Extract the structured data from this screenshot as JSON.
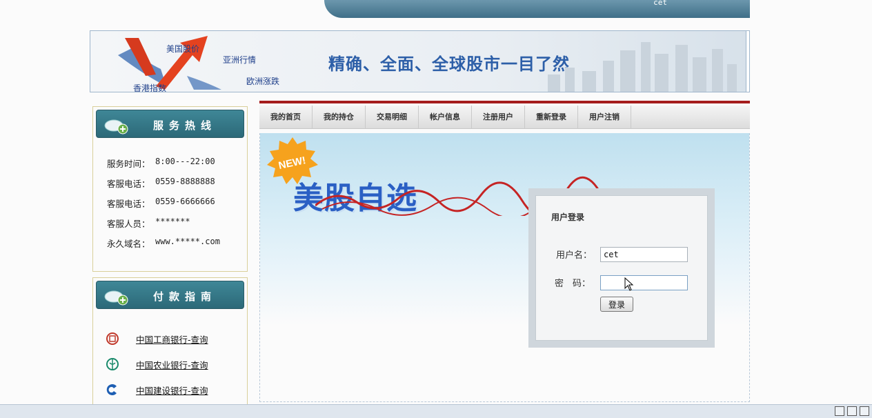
{
  "top_bar": {
    "username": "cet"
  },
  "banner": {
    "labels": {
      "us": "美国股价",
      "asia": "亚洲行情",
      "hk": "香港指数",
      "eu": "欧洲涨跌"
    },
    "slogan": "精确、全面、全球股市一目了然"
  },
  "service": {
    "title": "服务热线",
    "items": [
      {
        "label": "服务时间：",
        "value": "8:00---22:00"
      },
      {
        "label": "客服电话：",
        "value": "0559-8888888"
      },
      {
        "label": "客服电话：",
        "value": "0559-6666666"
      },
      {
        "label": "客服人员：",
        "value": "*******"
      },
      {
        "label": "永久域名：",
        "value": "www.*****.com"
      }
    ]
  },
  "payment": {
    "title": "付款指南",
    "banks": [
      {
        "name": "中国工商银行-查询",
        "icon": "icbc-logo-icon",
        "color": "#c0392b"
      },
      {
        "name": "中国农业银行-查询",
        "icon": "abc-logo-icon",
        "color": "#1a8a6b"
      },
      {
        "name": "中国建设银行-查询",
        "icon": "ccb-logo-icon",
        "color": "#1e5fb3"
      }
    ]
  },
  "nav": {
    "items": [
      "我的首页",
      "我的持仓",
      "交易明细",
      "帐户信息",
      "注册用户",
      "重新登录",
      "用户注销"
    ]
  },
  "hero": {
    "badge": "NEW!",
    "title": "美股自选"
  },
  "login": {
    "title": "用户登录",
    "username_label": "用户名：",
    "username_value": "cet",
    "password_label": "密　码：",
    "password_value": "",
    "submit_label": "登录"
  },
  "colors": {
    "accent_red": "#a51d1d",
    "header_teal": "#2c6978",
    "brand_blue": "#2d5fa8"
  }
}
